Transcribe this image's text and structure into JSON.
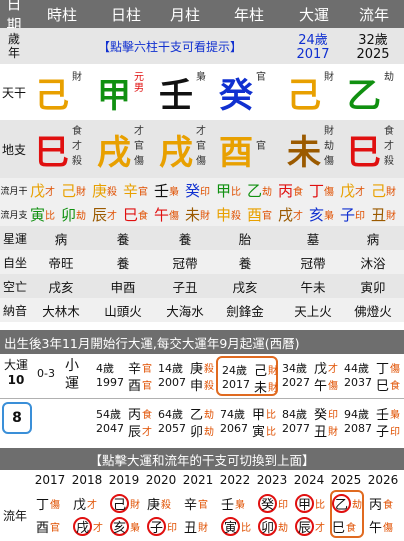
{
  "header": {
    "cols": [
      "日期",
      "時柱",
      "日柱",
      "月柱",
      "年柱",
      "大運",
      "流年"
    ]
  },
  "age_row": {
    "label": "歲\n年",
    "hint": "【點擊六柱干支可看提示】",
    "dayun_age": "24歲",
    "dayun_year": "2017",
    "liunian_age": "32歲",
    "liunian_year": "2025"
  },
  "tiangan": {
    "label": "天干",
    "stems": [
      {
        "char": "己",
        "color": "#e8a000",
        "god": "財"
      },
      {
        "char": "甲",
        "color": "#109010",
        "god": "元男"
      },
      {
        "char": "壬",
        "color": "#111111",
        "god": "梟"
      },
      {
        "char": "癸",
        "color": "#1030d0",
        "god": "官"
      },
      {
        "char": "己",
        "color": "#e8a000",
        "god": "財"
      },
      {
        "char": "乙",
        "color": "#109010",
        "god": "劫"
      }
    ]
  },
  "dizhi": {
    "label": "地支",
    "branches": [
      {
        "char": "巳",
        "color": "#e01010",
        "gods": [
          "食",
          "才",
          "殺"
        ]
      },
      {
        "char": "戌",
        "color": "#e8a000",
        "gods": [
          "才",
          "官",
          "傷"
        ]
      },
      {
        "char": "戌",
        "color": "#e8a000",
        "gods": [
          "才",
          "官",
          "傷"
        ]
      },
      {
        "char": "酉",
        "color": "#e8a000",
        "gods": [
          "",
          "官",
          ""
        ]
      },
      {
        "char": "未",
        "color": "#9b5a00",
        "gods": [
          "財",
          "劫",
          "傷"
        ]
      },
      {
        "char": "巳",
        "color": "#e01010",
        "gods": [
          "食",
          "才",
          "殺"
        ]
      }
    ]
  },
  "liuyue_gan": {
    "label": "流月干",
    "items": [
      "戊才",
      "己財",
      "庚殺",
      "辛官",
      "壬梟",
      "癸印",
      "甲比",
      "乙劫",
      "丙食",
      "丁傷",
      "戊才",
      "己財"
    ]
  },
  "liuyue_zhi": {
    "label": "流月支",
    "items": [
      "寅比",
      "卯劫",
      "辰才",
      "巳食",
      "午傷",
      "未財",
      "申殺",
      "酉官",
      "戌才",
      "亥梟",
      "子印",
      "丑財"
    ]
  },
  "xingyun": {
    "label": "星運",
    "values": [
      "病",
      "養",
      "養",
      "胎",
      "墓",
      "病"
    ]
  },
  "zizuo": {
    "label": "自坐",
    "values": [
      "帝旺",
      "養",
      "冠帶",
      "養",
      "冠帶",
      "沐浴"
    ]
  },
  "kongwang": {
    "label": "空亡",
    "values": [
      "戌亥",
      "申酉",
      "子丑",
      "戌亥",
      "午未",
      "寅卯"
    ]
  },
  "nayin": {
    "label": "納音",
    "values": [
      "大林木",
      "山頭火",
      "大海水",
      "劍鋒金",
      "天上火",
      "佛燈火"
    ]
  },
  "dayun_info": "出生後3年11月開始行大運,每交大運年9月起運(西曆)",
  "dayun": {
    "label": "大運",
    "count": "10",
    "current_index": "8",
    "xiaoyun_range": "0-3",
    "xiaoyun_label": "小\n運",
    "row1": [
      {
        "age": "4歲",
        "year": "1997",
        "gan": "辛",
        "gz": "官",
        "zhi": "酉",
        "zz": "官"
      },
      {
        "age": "14歲",
        "year": "2007",
        "gan": "庚",
        "gz": "殺",
        "zhi": "申",
        "zz": "殺"
      },
      {
        "age": "24歲",
        "year": "2017",
        "gan": "己",
        "gz": "財",
        "zhi": "未",
        "zz": "財"
      },
      {
        "age": "34歲",
        "year": "2027",
        "gan": "戊",
        "gz": "才",
        "zhi": "午",
        "zz": "傷"
      },
      {
        "age": "44歲",
        "year": "2037",
        "gan": "丁",
        "gz": "傷",
        "zhi": "巳",
        "zz": "食"
      }
    ],
    "row2": [
      {
        "age": "54歲",
        "year": "2047",
        "gan": "丙",
        "gz": "食",
        "zhi": "辰",
        "zz": "才"
      },
      {
        "age": "64歲",
        "year": "2057",
        "gan": "乙",
        "gz": "劫",
        "zhi": "卯",
        "zz": "劫"
      },
      {
        "age": "74歲",
        "year": "2067",
        "gan": "甲",
        "gz": "比",
        "zhi": "寅",
        "zz": "比"
      },
      {
        "age": "84歲",
        "year": "2077",
        "gan": "癸",
        "gz": "印",
        "zhi": "丑",
        "zz": "財"
      },
      {
        "age": "94歲",
        "year": "2087",
        "gan": "壬",
        "gz": "梟",
        "zhi": "子",
        "zz": "印"
      }
    ]
  },
  "switch_hint": "【點擊大運和流年的干支可切換到上面】",
  "liunian": {
    "label": "流年",
    "years": [
      "2017",
      "2018",
      "2019",
      "2020",
      "2021",
      "2022",
      "2023",
      "2024",
      "2025",
      "2026"
    ],
    "gan": [
      {
        "c": "丁",
        "g": "傷",
        "circle": false
      },
      {
        "c": "戊",
        "g": "才",
        "circle": false
      },
      {
        "c": "己",
        "g": "財",
        "circle": true
      },
      {
        "c": "庚",
        "g": "殺",
        "circle": false
      },
      {
        "c": "辛",
        "g": "官",
        "circle": false
      },
      {
        "c": "壬",
        "g": "梟",
        "circle": false
      },
      {
        "c": "癸",
        "g": "印",
        "circle": true
      },
      {
        "c": "甲",
        "g": "比",
        "circle": true
      },
      {
        "c": "乙",
        "g": "劫",
        "circle": true
      },
      {
        "c": "丙",
        "g": "食",
        "circle": false
      }
    ],
    "zhi": [
      {
        "c": "酉",
        "g": "官",
        "circle": false
      },
      {
        "c": "戌",
        "g": "才",
        "circle": true
      },
      {
        "c": "亥",
        "g": "梟",
        "circle": true
      },
      {
        "c": "子",
        "g": "印",
        "circle": true
      },
      {
        "c": "丑",
        "g": "財",
        "circle": false
      },
      {
        "c": "寅",
        "g": "比",
        "circle": true
      },
      {
        "c": "卯",
        "g": "劫",
        "circle": true
      },
      {
        "c": "辰",
        "g": "才",
        "circle": true
      },
      {
        "c": "巳",
        "g": "食",
        "circle": false
      },
      {
        "c": "午",
        "g": "傷",
        "circle": false
      }
    ]
  }
}
